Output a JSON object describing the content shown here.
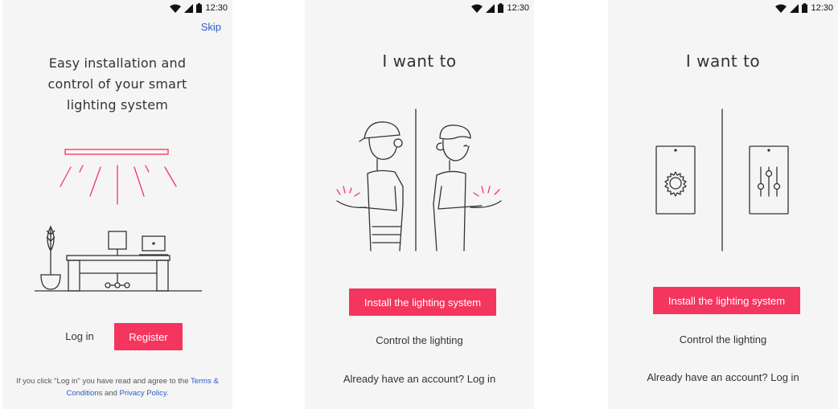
{
  "status_bar": {
    "time": "12:30"
  },
  "screens": [
    {
      "skip_label": "Skip",
      "headline": "Easy installation and\ncontrol of your smart\nlighting system",
      "login_label": "Log in",
      "register_label": "Register",
      "legal": {
        "prefix": "If you click \"Log in\" you have read and agree to the",
        "terms_link": "Terms & Conditions",
        "joiner": "and",
        "privacy_link": "Privacy Policy",
        "suffix": "."
      }
    },
    {
      "headline": "I want to",
      "install_label": "Install the lighting system",
      "control_label": "Control the lighting",
      "account_label": "Already have an account? Log in"
    },
    {
      "headline": "I want to",
      "install_label": "Install the lighting system",
      "control_label": "Control the lighting",
      "account_label": "Already have an account? Log in"
    }
  ],
  "colors": {
    "accent": "#f4355d",
    "link": "#2a5cc7",
    "background": "#f5f5f5",
    "line_art": "#333333"
  },
  "icons": [
    "wifi-icon",
    "cellular-signal-icon",
    "battery-icon",
    "gear-icon",
    "sliders-icon"
  ]
}
